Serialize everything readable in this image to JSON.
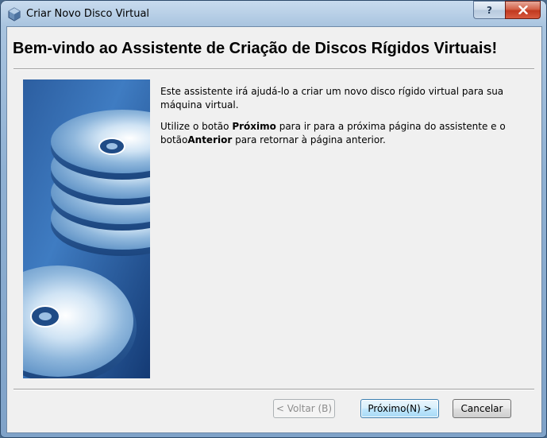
{
  "window": {
    "title": "Criar Novo Disco Virtual",
    "help_label": "?",
    "close_label": "✕"
  },
  "header": {
    "title": "Bem-vindo ao Assistente de Criação de Discos Rígidos Virtuais!"
  },
  "body": {
    "paragraph1": "Este assistente irá ajudá-lo a criar um novo disco rígido virtual para sua máquina virtual.",
    "p2_prefix": "Utilize o botão ",
    "p2_next_word": "Próximo",
    "p2_middle": " para ir para a próxima página do assistente e o botão",
    "p2_back_word": "Anterior",
    "p2_suffix": " para retornar à página anterior."
  },
  "buttons": {
    "back_label": "< Voltar (B)",
    "next_label": "Próximo(N) >",
    "cancel_label": "Cancelar",
    "back_enabled": false
  },
  "colors": {
    "accent": "#3c7fb1",
    "close_red": "#c1391f",
    "dialog_bg": "#f0f0f0"
  },
  "icons": {
    "app": "virtualbox-cube-icon",
    "side_art": "stacked-discs-illustration"
  }
}
